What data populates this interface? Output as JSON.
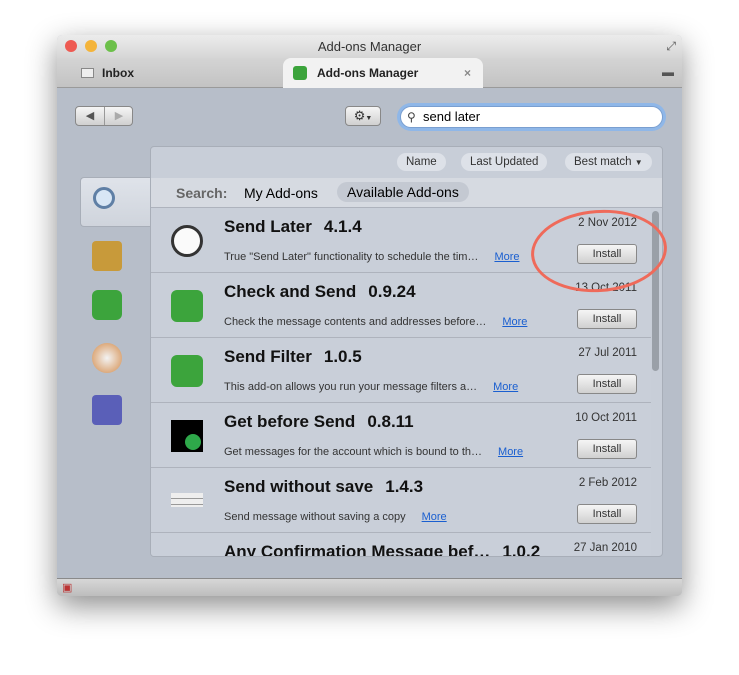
{
  "window": {
    "title": "Add-ons Manager"
  },
  "tabs": [
    {
      "label": "Inbox"
    },
    {
      "label": "Add-ons Manager"
    }
  ],
  "toolbar": {
    "search_value": "send later"
  },
  "sort": {
    "name": "Name",
    "last_updated": "Last Updated",
    "best_match": "Best match"
  },
  "scope": {
    "label": "Search:",
    "my_addons": "My Add-ons",
    "available": "Available Add-ons"
  },
  "install_label": "Install",
  "more_label": "More",
  "results": [
    {
      "name": "Send Later",
      "version": "4.1.4",
      "date": "2 Nov 2012",
      "desc": "True \"Send Later\" functionality to schedule the tim…",
      "icon": "clock-icon"
    },
    {
      "name": "Check and Send",
      "version": "0.9.24",
      "date": "13 Oct 2011",
      "desc": "Check the message contents and addresses before…",
      "icon": "puzzle-icon"
    },
    {
      "name": "Send Filter",
      "version": "1.0.5",
      "date": "27 Jul 2011",
      "desc": "This add-on allows you run your message filters a…",
      "icon": "puzzle-icon"
    },
    {
      "name": "Get before Send",
      "version": "0.8.11",
      "date": "10 Oct 2011",
      "desc": "Get messages for the account which is bound to th…",
      "icon": "mail-arrow-icon"
    },
    {
      "name": "Send without save",
      "version": "1.4.3",
      "date": "2 Feb 2012",
      "desc": "Send message without saving a copy",
      "icon": "menu-screenshot-icon"
    },
    {
      "name": "Any Confirmation Message bef…",
      "version": "1.0.2",
      "date": "27 Jan 2010",
      "desc": "",
      "icon": "puzzle-icon"
    }
  ],
  "colors": {
    "annotation": "#ef6a5a",
    "link": "#1a5fd0"
  }
}
